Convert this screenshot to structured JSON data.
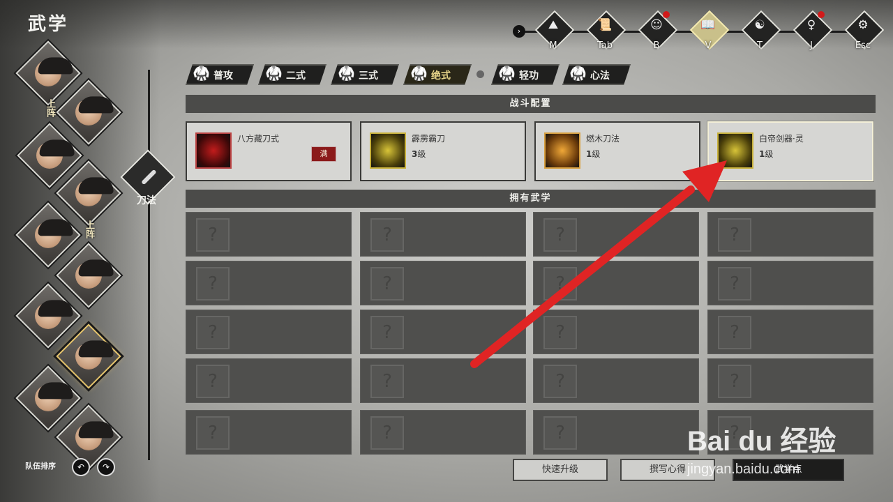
{
  "title": "武学",
  "nav": {
    "icons": [
      {
        "name": "map",
        "symbol": "⛰",
        "key": "M",
        "badge": false,
        "active": false
      },
      {
        "name": "scroll",
        "symbol": "📜",
        "key": "Tab",
        "badge": false,
        "active": false
      },
      {
        "name": "bag",
        "symbol": "☺",
        "key": "B",
        "badge": true,
        "active": false
      },
      {
        "name": "martial",
        "symbol": "📖",
        "key": "V",
        "badge": false,
        "active": true
      },
      {
        "name": "talent",
        "symbol": "☯",
        "key": "T",
        "badge": false,
        "active": false
      },
      {
        "name": "meditate",
        "symbol": "♀",
        "key": "J",
        "badge": true,
        "active": false
      },
      {
        "name": "system",
        "symbol": "⚙",
        "key": "Esc",
        "badge": false,
        "active": false
      }
    ]
  },
  "categories": [
    {
      "label": "普攻",
      "active": false
    },
    {
      "label": "二式",
      "active": false
    },
    {
      "label": "三式",
      "active": false
    },
    {
      "label": "绝式",
      "active": true
    },
    {
      "label": "轻功",
      "active": false
    },
    {
      "label": "心法",
      "active": false
    }
  ],
  "sections": {
    "combat": "战斗配置",
    "owned": "拥有武学"
  },
  "combat_skills": [
    {
      "name": "八方藏刀式",
      "level_num": "",
      "level_unit": "",
      "max_label": "满",
      "style": "red"
    },
    {
      "name": "霹雳霸刀",
      "level_num": "3",
      "level_unit": "级",
      "max_label": "",
      "style": "gold"
    },
    {
      "name": "燃木刀法",
      "level_num": "1",
      "level_unit": "级",
      "max_label": "",
      "style": "fire"
    },
    {
      "name": "白帝剑器·灵",
      "level_num": "1",
      "level_unit": "级",
      "max_label": "",
      "style": "gold"
    }
  ],
  "owned_placeholder": "?",
  "weapon": {
    "label": "刀法"
  },
  "party": {
    "deploy_tags": [
      "上阵",
      "上阵"
    ],
    "sort_label": "队伍排序"
  },
  "buttons": {
    "quick_upgrade": "快速升级",
    "write_notes": "撰写心得",
    "martial_points": "武学点"
  },
  "watermark": {
    "logo": "Bai du 经验",
    "sub": "jingyan.baidu.com"
  },
  "colors": {
    "annotation_arrow": "#e02424",
    "gold": "#e5c36a",
    "max_badge": "#8b1a1a"
  }
}
